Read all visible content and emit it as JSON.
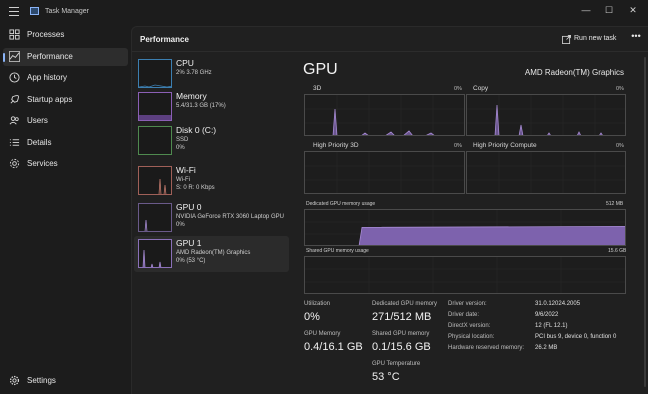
{
  "window": {
    "title": "Task Manager",
    "minimize_icon": "—",
    "maximize_icon": "☐",
    "close_icon": "✕"
  },
  "sidebar": {
    "items": [
      {
        "label": "Processes",
        "icon": "grid-icon"
      },
      {
        "label": "Performance",
        "icon": "performance-icon",
        "active": true
      },
      {
        "label": "App history",
        "icon": "history-icon"
      },
      {
        "label": "Startup apps",
        "icon": "startup-icon"
      },
      {
        "label": "Users",
        "icon": "users-icon"
      },
      {
        "label": "Details",
        "icon": "details-icon"
      },
      {
        "label": "Services",
        "icon": "services-icon"
      }
    ],
    "settings_label": "Settings"
  },
  "header": {
    "title": "Performance",
    "run_task_label": "Run new task",
    "more_label": "•••"
  },
  "resources": [
    {
      "name": "CPU",
      "sub1": "2% 3.78 GHz",
      "sub2": ""
    },
    {
      "name": "Memory",
      "sub1": "5.4/31.3 GB (17%)",
      "sub2": ""
    },
    {
      "name": "Disk 0 (C:)",
      "sub1": "SSD",
      "sub2": "0%"
    },
    {
      "name": "Wi-Fi",
      "sub1": "Wi-Fi",
      "sub2": "S: 0 R: 0 Kbps"
    },
    {
      "name": "GPU 0",
      "sub1": "NVIDIA GeForce RTX 3060 Laptop GPU",
      "sub2": "0%"
    },
    {
      "name": "GPU 1",
      "sub1": "AMD Radeon(TM) Graphics",
      "sub2": "0% (53 °C)",
      "active": true
    }
  ],
  "detail": {
    "title": "GPU",
    "model": "AMD Radeon(TM) Graphics",
    "graphs": {
      "g3d": {
        "label": "3D",
        "pct": "0%"
      },
      "copy": {
        "label": "Copy",
        "pct": "0%"
      },
      "hp3d": {
        "label": "High Priority 3D",
        "pct": "0%"
      },
      "hpcompute": {
        "label": "High Priority Compute",
        "pct": "0%"
      },
      "dedicated": {
        "label": "Dedicated GPU memory usage",
        "max": "512 MB",
        "level_fraction": 0.53
      },
      "shared": {
        "label": "Shared GPU memory usage",
        "max": "15.6 GB"
      }
    },
    "stats": {
      "utilization": {
        "label": "Utilization",
        "value": "0%"
      },
      "dedicated_mem": {
        "label": "Dedicated GPU memory",
        "value": "271/512 MB"
      },
      "gpu_memory": {
        "label": "GPU Memory",
        "value": "0.4/16.1 GB"
      },
      "shared_mem": {
        "label": "Shared GPU memory",
        "value": "0.1/15.6 GB"
      },
      "temperature": {
        "label": "GPU Temperature",
        "value": "53 °C"
      }
    },
    "info": [
      {
        "label": "Driver version:",
        "value": "31.0.12024.2005"
      },
      {
        "label": "Driver date:",
        "value": "9/6/2022"
      },
      {
        "label": "DirectX version:",
        "value": "12 (FL 12.1)"
      },
      {
        "label": "Physical location:",
        "value": "PCI bus 9, device 0, function 0"
      },
      {
        "label": "Hardware reserved memory:",
        "value": "26.2 MB"
      }
    ]
  },
  "colors": {
    "accent": "#8ab4f8",
    "gpu_graph": "#a78bd4",
    "gpu_fill": "#7d62ad"
  }
}
